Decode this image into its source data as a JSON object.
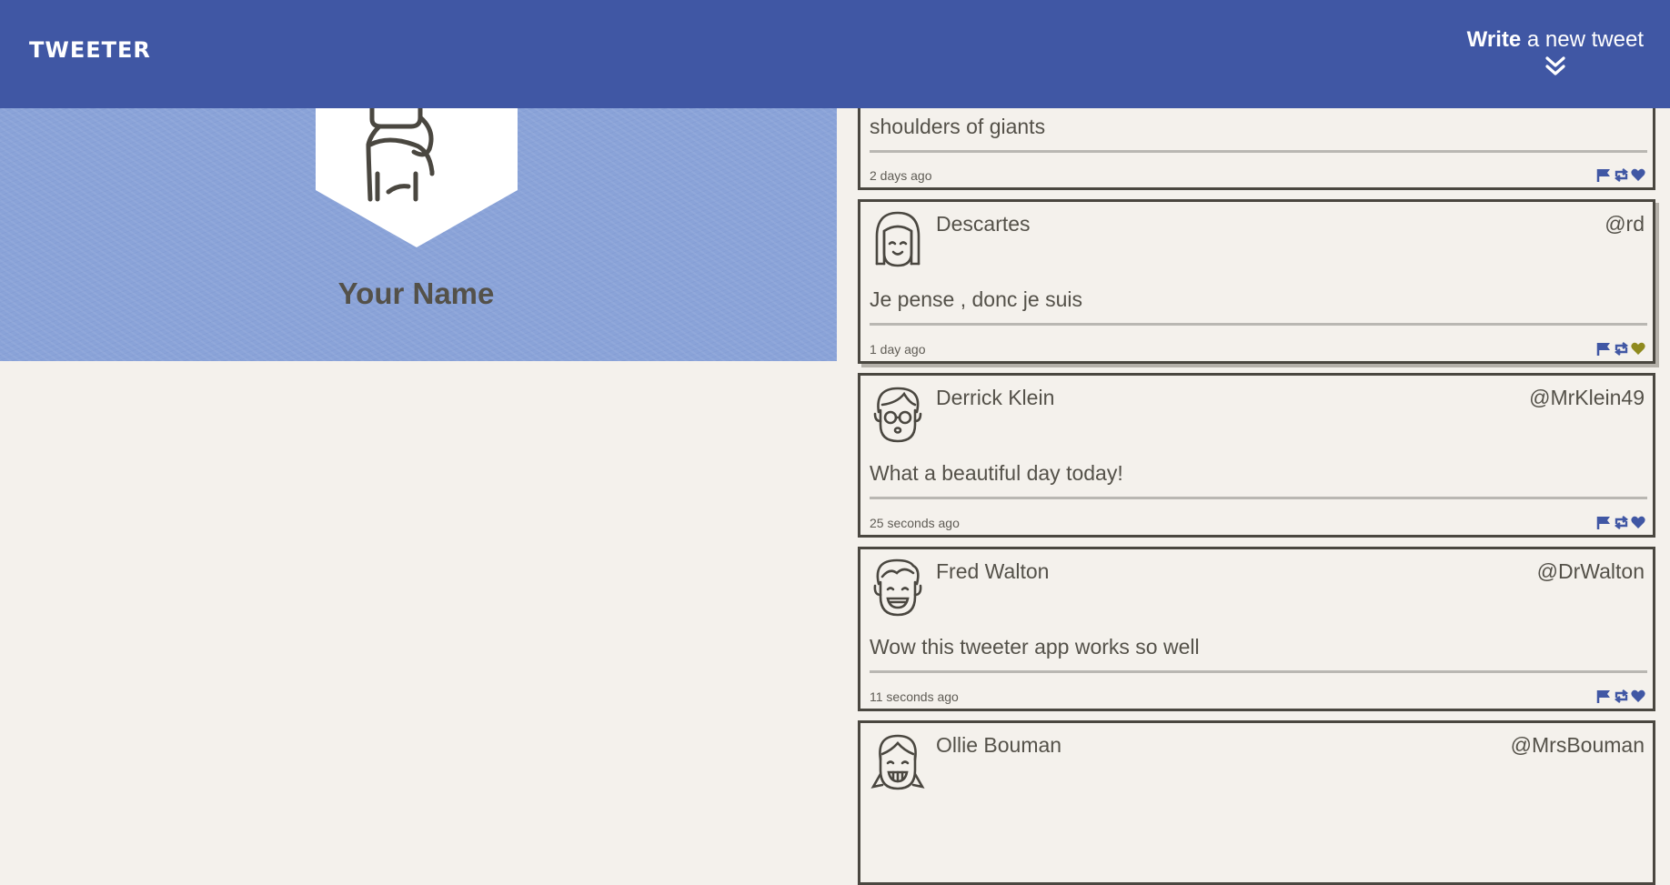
{
  "header": {
    "logo": "TWEETER",
    "compose_bold": "Write",
    "compose_rest": " a new tweet",
    "compose_icon": "double-chevron-down-icon"
  },
  "profile": {
    "name": "Your Name",
    "avatar_icon": "user-avatar-icon"
  },
  "colors": {
    "header_bg": "#4057a4",
    "profile_bg": "#8aa3d8",
    "page_bg": "#f4f1ec",
    "action_blue": "#4057a4",
    "liked_olive": "#8f8a1e"
  },
  "tweets": [
    {
      "name": "",
      "handle": "",
      "text": "shoulders of giants",
      "time": "2 days ago",
      "liked": false
    },
    {
      "name": "Descartes",
      "handle": "@rd",
      "text": "Je pense , donc je suis",
      "time": "1 day ago",
      "liked": true
    },
    {
      "name": "Derrick Klein",
      "handle": "@MrKlein49",
      "text": "What a beautiful day today!",
      "time": "25 seconds ago",
      "liked": false
    },
    {
      "name": "Fred Walton",
      "handle": "@DrWalton",
      "text": "Wow this tweeter app works so well",
      "time": "11 seconds ago",
      "liked": false
    },
    {
      "name": "Ollie Bouman",
      "handle": "@MrsBouman",
      "text": "",
      "time": "",
      "liked": false
    }
  ],
  "action_icons": [
    "flag-icon",
    "retweet-icon",
    "heart-icon"
  ]
}
